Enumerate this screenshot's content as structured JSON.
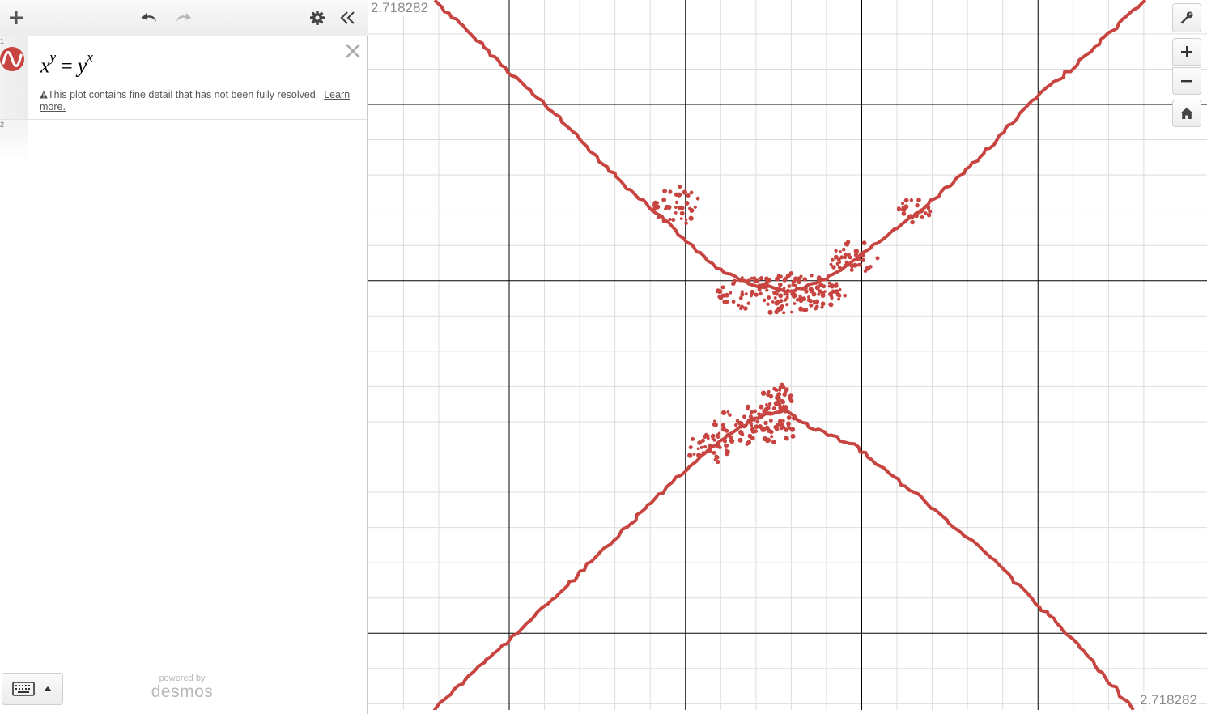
{
  "toolbar": {
    "add_icon": "plus-icon",
    "undo_icon": "undo-icon",
    "redo_icon": "redo-icon",
    "settings_icon": "gear-icon",
    "collapse_icon": "double-chevron-left-icon"
  },
  "expressions": [
    {
      "index": "1",
      "latex_base_left": "x",
      "latex_exp_left": "y",
      "equals": "=",
      "latex_base_right": "y",
      "latex_exp_right": "x",
      "color": "#c74440",
      "warning_text": "This plot contains fine detail that has not been fully resolved.",
      "warning_link": "Learn more."
    },
    {
      "index": "2"
    }
  ],
  "footer": {
    "powered_by": "powered by",
    "brand": "desmos"
  },
  "graph": {
    "top_left_label": "2.718282",
    "bottom_right_label": "2.718282",
    "curve_color": "#c74440",
    "grid_minor_color": "#dddddd",
    "grid_major_color": "#000000"
  },
  "graph_controls": {
    "settings_icon": "wrench-icon",
    "zoom_in_icon": "plus-icon",
    "zoom_out_icon": "minus-icon",
    "home_icon": "home-icon"
  }
}
